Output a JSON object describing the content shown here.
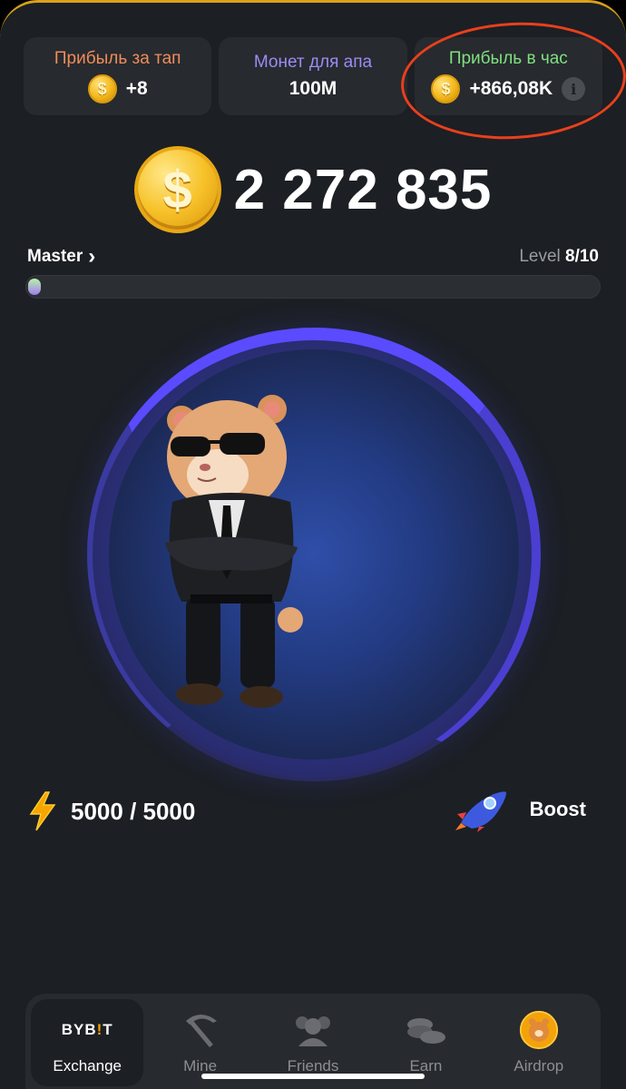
{
  "stats": [
    {
      "label": "Прибыль за тап",
      "value": "+8",
      "label_color": "#f08c5a"
    },
    {
      "label": "Монет для апа",
      "value": "100M",
      "label_color": "#9b8cf4"
    },
    {
      "label": "Прибыль в час",
      "value": "+866,08K",
      "label_color": "#7fe07f"
    }
  ],
  "balance": {
    "coin_symbol": "$",
    "value": "2 272 835"
  },
  "level": {
    "name": "Master",
    "chevron": "›",
    "prefix": "Level",
    "value": "8/10",
    "progress_fraction": 0.02
  },
  "energy": {
    "value": "5000 / 5000",
    "icon": "lightning-icon"
  },
  "boost": {
    "label": "Boost",
    "icon": "rocket-icon"
  },
  "nav": [
    {
      "label": "Exchange",
      "icon": "bybit-logo",
      "brand": "BYBIT",
      "active": true
    },
    {
      "label": "Mine",
      "icon": "pickaxe-icon"
    },
    {
      "label": "Friends",
      "icon": "friends-icon"
    },
    {
      "label": "Earn",
      "icon": "coins-icon"
    },
    {
      "label": "Airdrop",
      "icon": "hamster-coin-icon"
    }
  ],
  "colors": {
    "accent": "#d9a21a",
    "highlight": "#e8401c",
    "tap_ring": "#5a4bff"
  }
}
